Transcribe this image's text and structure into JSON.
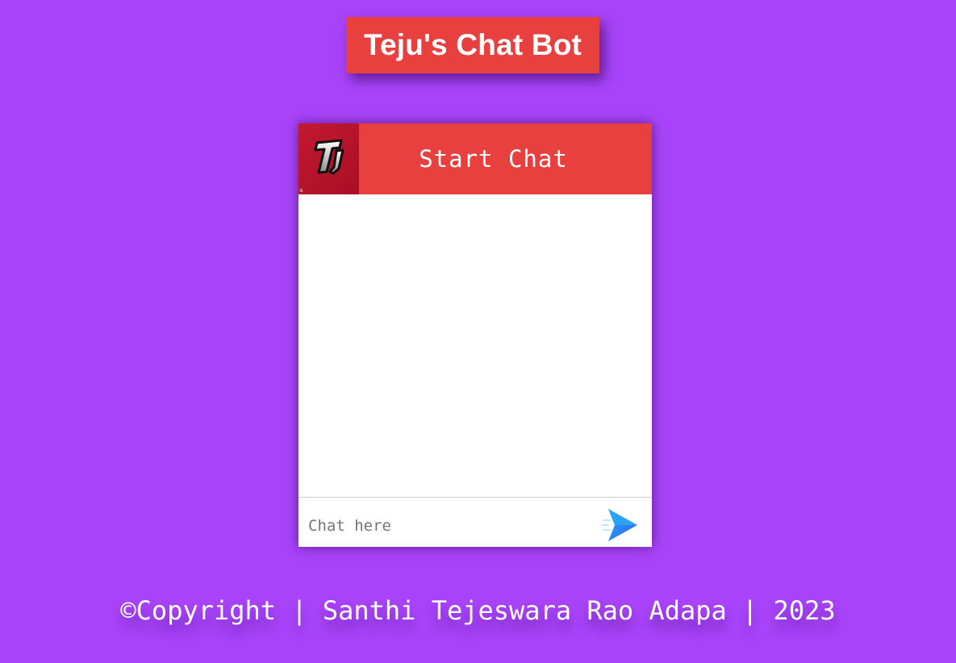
{
  "page": {
    "title": "Teju's Chat Bot",
    "background_color": "#a843fa",
    "accent_color": "#e8403f"
  },
  "chat": {
    "logo_icon": "tj-logo-icon",
    "header_title": "Start Chat",
    "input_placeholder": "Chat here",
    "input_value": "",
    "send_icon": "send-arrow-icon"
  },
  "footer": {
    "text": "©Copyright | Santhi Tejeswara Rao Adapa | 2023"
  }
}
